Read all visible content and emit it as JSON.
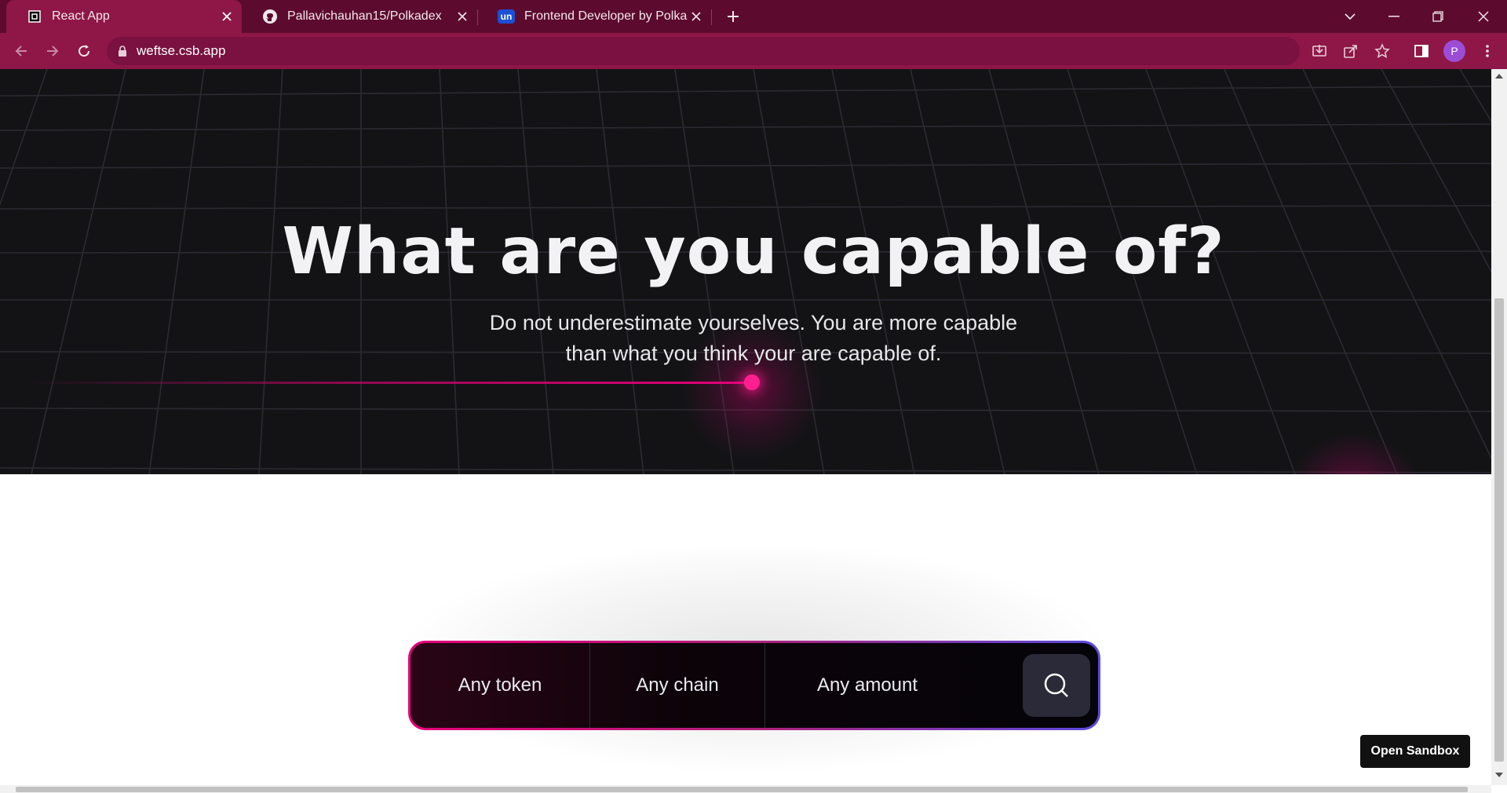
{
  "browser": {
    "tabs": [
      {
        "title": "React App",
        "favicon": "codesandbox-square-icon"
      },
      {
        "title": "Pallavichauhan15/Polkadex",
        "favicon": "github-icon"
      },
      {
        "title": "Frontend Developer by Polkadex",
        "favicon": "unstop-icon",
        "favicon_text": "un"
      }
    ],
    "url": "weftse.csb.app",
    "profile_initial": "P",
    "colors": {
      "tabstrip": "#5c0b2e",
      "toolbar": "#8e1747",
      "avatar": "#9b4dd6"
    }
  },
  "hero": {
    "title": "What are you capable of?",
    "subtitle_line1": "Do not underestimate yourselves. You are more capable",
    "subtitle_line2": "than what you think your are capable of."
  },
  "search": {
    "token_label": "Any token",
    "chain_label": "Any chain",
    "amount_label": "Any amount"
  },
  "sandbox_button": "Open Sandbox",
  "theme": {
    "accent": "#e6007a",
    "hero_bg": "#131316",
    "border_end": "#5a4ae0"
  }
}
